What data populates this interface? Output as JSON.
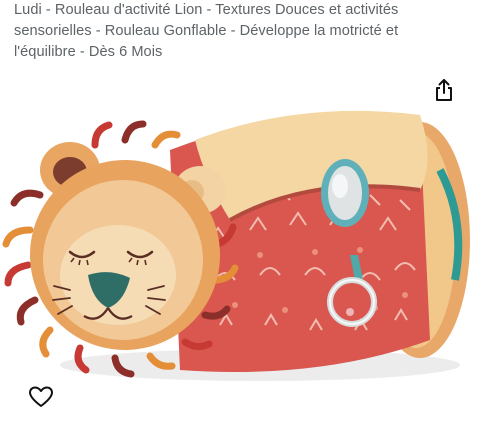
{
  "product": {
    "title": "Ludi - Rouleau d'activité Lion - Textures Douces et activités sensorielles - Rouleau Gonflable - Développe la motricté et l'équilibre - Dès 6 Mois"
  },
  "actions": {
    "share_icon": "share-icon",
    "favorite_icon": "heart-icon"
  },
  "colors": {
    "roll": "#d9574e",
    "lion_face": "#f1c896",
    "nose": "#2f6e66",
    "mirror_frame": "#5fb0b8",
    "plush": "#f4d7a2"
  }
}
